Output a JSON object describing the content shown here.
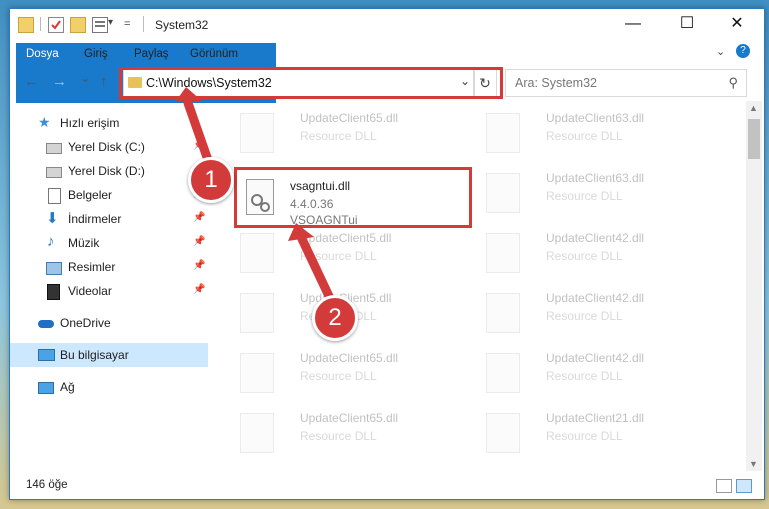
{
  "window": {
    "title": "System32",
    "controls": {
      "minimize": "—",
      "maximize": "☐",
      "close": "✕"
    }
  },
  "ribbon": {
    "tabs": [
      "Dosya",
      "Giriş",
      "Paylaş",
      "Görünüm"
    ],
    "expand_icon": "chevron-down-icon",
    "help_icon": "help-icon"
  },
  "navigation": {
    "back": "←",
    "forward": "→",
    "recent": "⌄",
    "up": "↑",
    "address": "C:\\Windows\\System32",
    "search_placeholder": "Ara: System32"
  },
  "sidebar": {
    "items": [
      {
        "label": "Hızlı erişim",
        "icon": "star-icon",
        "pinned": false
      },
      {
        "label": "Yerel Disk (C:)",
        "icon": "drive-icon",
        "pinned": true
      },
      {
        "label": "Yerel Disk (D:)",
        "icon": "drive-icon",
        "pinned": true
      },
      {
        "label": "Belgeler",
        "icon": "documents-icon",
        "pinned": true
      },
      {
        "label": "İndirmeler",
        "icon": "download-icon",
        "pinned": true
      },
      {
        "label": "Müzik",
        "icon": "music-icon",
        "pinned": true
      },
      {
        "label": "Resimler",
        "icon": "pictures-icon",
        "pinned": true
      },
      {
        "label": "Videolar",
        "icon": "video-icon",
        "pinned": true
      },
      {
        "label": "OneDrive",
        "icon": "cloud-icon",
        "pinned": false
      },
      {
        "label": "Bu bilgisayar",
        "icon": "computer-icon",
        "pinned": false,
        "selected": true
      },
      {
        "label": "Ağ",
        "icon": "network-icon",
        "pinned": false
      }
    ],
    "pin_glyph": "📌"
  },
  "files": {
    "highlighted": {
      "name": "vsagntui.dll",
      "version": "4.4.0.36",
      "description": "VSOAGNTui"
    },
    "left_column": [
      {
        "name": "UpdateClient65.dll",
        "description": "Resource DLL"
      },
      {
        "name": "UpdateClient5.dll",
        "description": "Resource DLL"
      },
      {
        "name": "UpdateClient5.dll",
        "description": "Resource DLL"
      },
      {
        "name": "UpdateClient65.dll",
        "description": "Resource DLL"
      },
      {
        "name": "UpdateClient65.dll",
        "description": "Resource DLL"
      }
    ],
    "right_column": [
      {
        "name": "UpdateClient63.dll",
        "description": "Resource DLL"
      },
      {
        "name": "UpdateClient63.dll",
        "description": "Resource DLL"
      },
      {
        "name": "UpdateClient42.dll",
        "description": "Resource DLL"
      },
      {
        "name": "UpdateClient42.dll",
        "description": "Resource DLL"
      },
      {
        "name": "UpdateClient42.dll",
        "description": "Resource DLL"
      },
      {
        "name": "UpdateClient21.dll",
        "description": "Resource DLL"
      }
    ]
  },
  "status": {
    "item_count": "146 öğe"
  },
  "annotations": {
    "step1": "1",
    "step2": "2",
    "color": "#d33a3a"
  }
}
